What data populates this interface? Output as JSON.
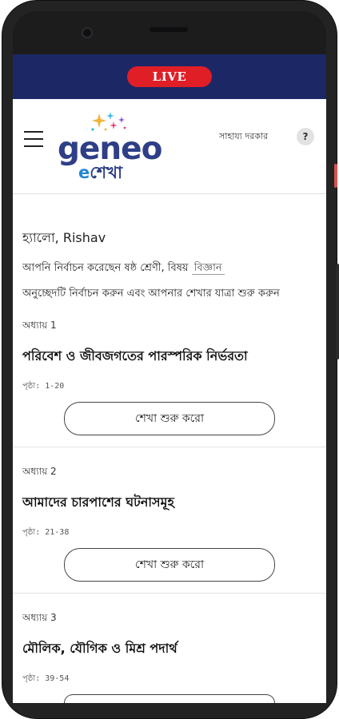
{
  "live_banner": {
    "label": "LIVE",
    "bar_color": "#1c2766",
    "pill_color": "#e01e26"
  },
  "header": {
    "menu_icon": "hamburger-menu-icon",
    "logo": {
      "word": "geneo",
      "sub_prefix": "e",
      "sub_text": "শেখা",
      "color": "#2e3f87"
    },
    "help_text": "সাহায্য দরকার",
    "help_icon": "?"
  },
  "intro": {
    "greeting": "হ্যালো, Rishav",
    "selection_prefix": "আপনি নির্বাচন করেছেন ষষ্ঠ শ্রেণী, বিষয়",
    "subject": "বিজ্ঞান",
    "instruction": "অনুচ্ছেদটি নির্বাচন করুন এবং আপনার শেখার যাত্রা শুরু করুন"
  },
  "chapters": [
    {
      "label": "অধ্যায় 1",
      "title": "পরিবেশ ও জীবজগতের পারস্পরিক নির্ভরতা",
      "pages": "পৃষ্ঠা: 1-20",
      "button": "শেখা শুরু করো"
    },
    {
      "label": "অধ্যায় 2",
      "title": "আমাদের চারপাশের ঘটনাসমূহ",
      "pages": "পৃষ্ঠা: 21-38",
      "button": "শেখা শুরু করো"
    },
    {
      "label": "অধ্যায় 3",
      "title": "মৌলিক, যৌগিক ও মিশ্র পদার্থ",
      "pages": "পৃষ্ঠা: 39-54"
    }
  ]
}
